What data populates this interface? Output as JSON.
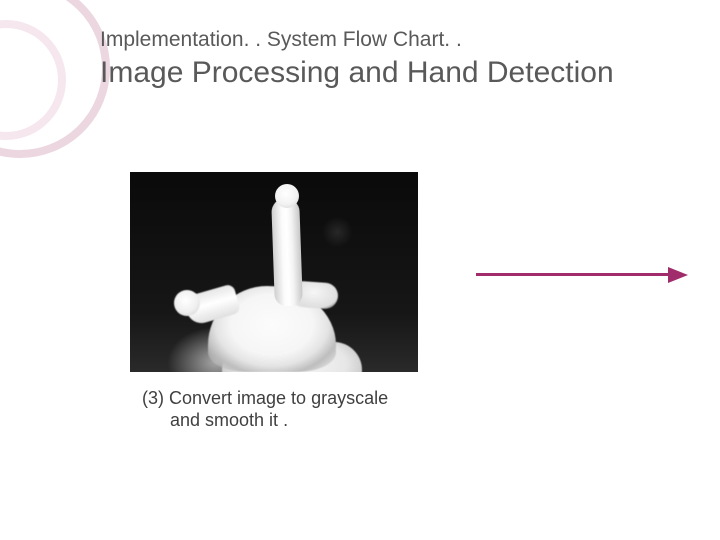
{
  "header": {
    "breadcrumb": "Implementation. . System Flow Chart. .",
    "title": "Image Processing and Hand Detection"
  },
  "figure": {
    "alt": "grayscale-hand-pointing-up",
    "caption_line1": "(3) Convert image to grayscale",
    "caption_line2": "and smooth it ."
  },
  "colors": {
    "accent": "#a02c6b"
  }
}
